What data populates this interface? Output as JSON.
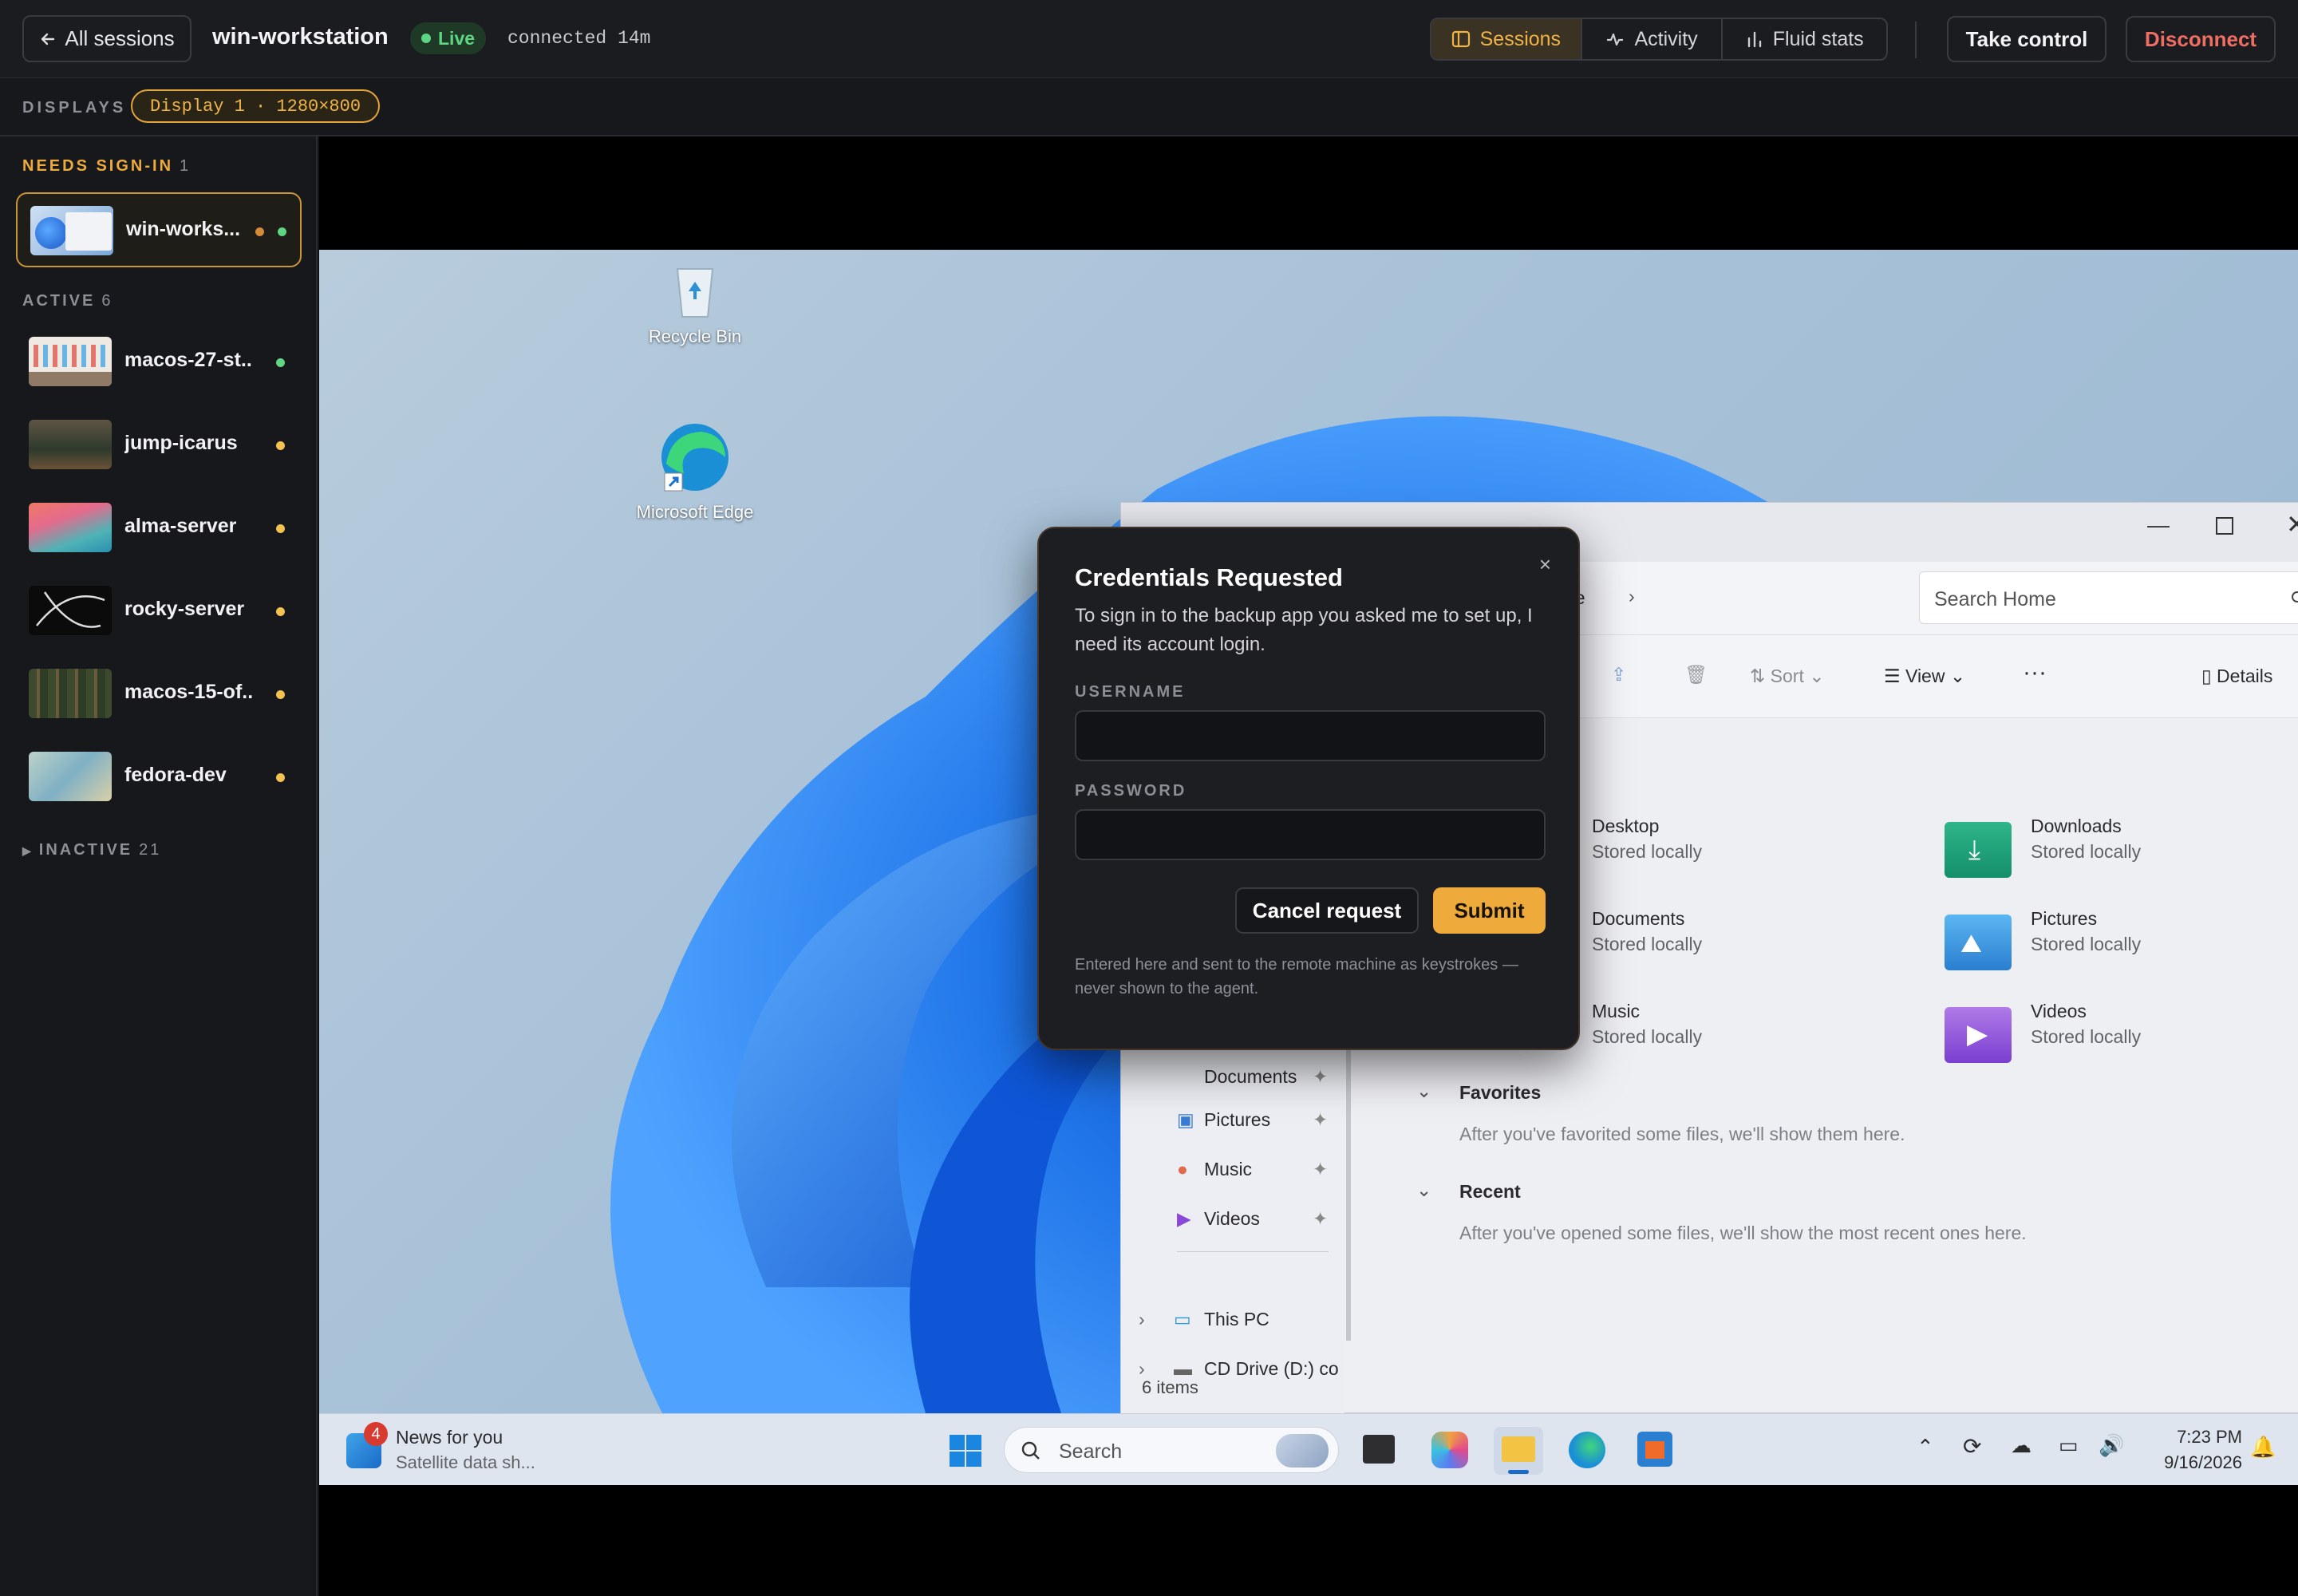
{
  "header": {
    "back_label": "All sessions",
    "host": "win-workstation",
    "live_label": "Live",
    "connected": "connected 14m",
    "tabs": [
      {
        "label": "Sessions",
        "icon": "sessions-icon",
        "active": true
      },
      {
        "label": "Activity",
        "icon": "activity-icon"
      },
      {
        "label": "Fluid stats",
        "icon": "bar-chart-icon"
      }
    ],
    "take_control": "Take control",
    "disconnect": "Disconnect"
  },
  "displays": {
    "label": "DISPLAYS",
    "current": "Display 1 · 1280×800"
  },
  "sidebar": {
    "needs_signin": {
      "label": "NEEDS SIGN-IN",
      "count": "1"
    },
    "active": {
      "label": "ACTIVE",
      "count": "6"
    },
    "inactive": {
      "label": "INACTIVE",
      "count": "21"
    },
    "sessions": [
      {
        "name": "win-works...",
        "status": "needs-sign-in"
      },
      {
        "name": "macos-27-st...",
        "status": "online"
      },
      {
        "name": "jump-icarus",
        "status": "idle"
      },
      {
        "name": "alma-server",
        "status": "idle"
      },
      {
        "name": "rocky-server",
        "status": "idle"
      },
      {
        "name": "macos-15-of...",
        "status": "idle"
      },
      {
        "name": "fedora-dev",
        "status": "idle"
      }
    ]
  },
  "desktop": {
    "icons": [
      "Recycle Bin",
      "Microsoft Edge"
    ],
    "explorer": {
      "crumb": "ne",
      "search_placeholder": "Search Home",
      "toolbar": {
        "sort": "Sort",
        "view": "View",
        "details": "Details"
      },
      "quick_access": [
        {
          "name": "Desktop",
          "sub": "Stored locally"
        },
        {
          "name": "Downloads",
          "sub": "Stored locally"
        },
        {
          "name": "Documents",
          "sub": "Stored locally"
        },
        {
          "name": "Pictures",
          "sub": "Stored locally"
        },
        {
          "name": "Music",
          "sub": "Stored locally"
        },
        {
          "name": "Videos",
          "sub": "Stored locally"
        }
      ],
      "favorites_title": "Favorites",
      "favorites_msg": "After you've favorited some files, we'll show them here.",
      "recent_title": "Recent",
      "recent_msg": "After you've opened some files, we'll show the most recent ones here.",
      "nav": [
        "Documents",
        "Pictures",
        "Music",
        "Videos",
        "This PC",
        "CD Drive (D:) co"
      ],
      "status": "6 items"
    },
    "taskbar": {
      "news_title": "News for you",
      "news_sub": "Satellite data sh...",
      "news_badge": "4",
      "search": "Search",
      "time": "7:23 PM",
      "date": "9/16/2026"
    }
  },
  "modal": {
    "title": "Credentials Requested",
    "description": "To sign in to the backup app you asked me to set up, I need its account login.",
    "username_label": "USERNAME",
    "username_value": "",
    "password_label": "PASSWORD",
    "password_value": "",
    "cancel": "Cancel request",
    "submit": "Submit",
    "note": "Entered here and sent to the remote machine as keystrokes — never shown to the agent.",
    "close": "×"
  },
  "colors": {
    "accent": "#eeaa3a",
    "live": "#5dd583",
    "danger": "#ef6e63",
    "warning_dot": "#f2c14e",
    "needs_signin_dot": "#d48a36"
  }
}
